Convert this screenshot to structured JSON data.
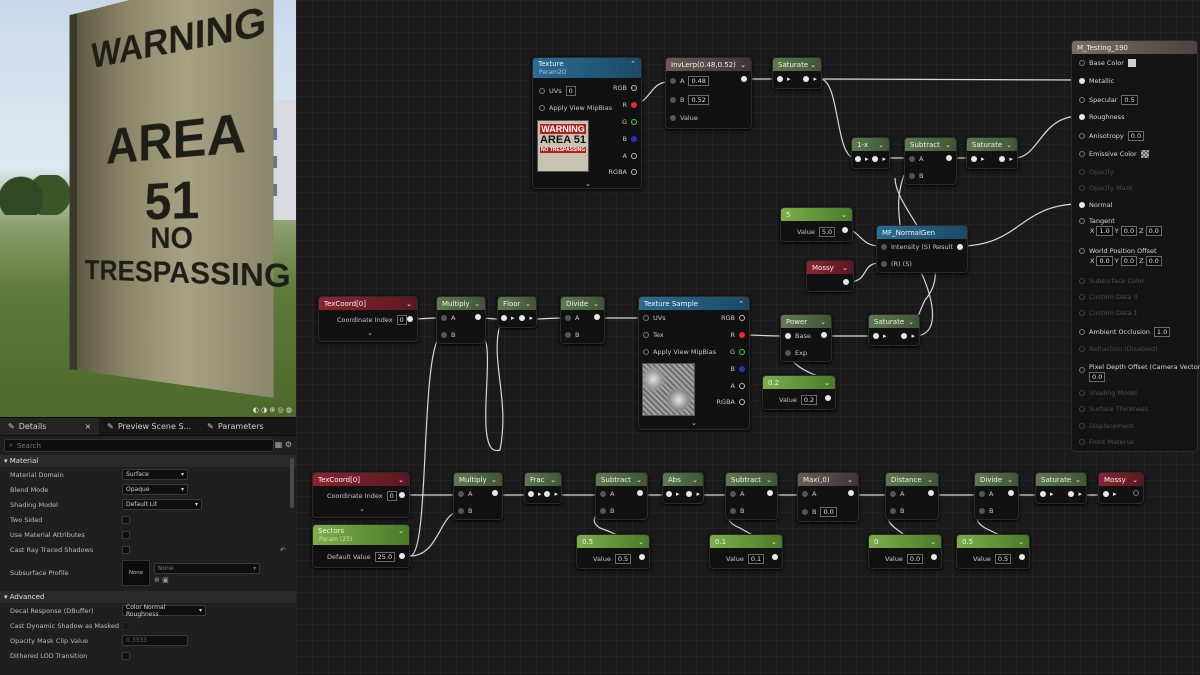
{
  "viewport": {
    "sign_lines": [
      "WARNING",
      "AREA 51",
      "NO TRESPASSING"
    ]
  },
  "details": {
    "tabs": [
      "Details",
      "Preview Scene S...",
      "Parameters"
    ],
    "search_placeholder": "Search",
    "sections": {
      "material": "Material",
      "advanced": "Advanced"
    },
    "rows": {
      "material_domain": {
        "label": "Material Domain",
        "value": "Surface"
      },
      "blend_mode": {
        "label": "Blend Mode",
        "value": "Opaque"
      },
      "shading_model": {
        "label": "Shading Model",
        "value": "Default Lit"
      },
      "two_sided": "Two Sided",
      "use_material_attributes": "Use Material Attributes",
      "cast_ray_traced_shadows": "Cast Ray Traced Shadows",
      "subsurface_profile": {
        "label": "Subsurface Profile",
        "thumb": "None",
        "value": "None"
      },
      "decal_response": {
        "label": "Decal Response (DBuffer)",
        "value": "Color Normal Roughness"
      },
      "cast_dynamic_shadow": "Cast Dynamic Shadow as Masked",
      "opacity_mask_clip": {
        "label": "Opacity Mask Clip Value",
        "value": "0.3333"
      },
      "dithered_lod": "Dithered LOD Transition"
    }
  },
  "nodes": {
    "texture": {
      "title": "Texture",
      "sub": "Param2D",
      "uvs": "UVs",
      "uvs_val": "0",
      "mip": "Apply View MipBias",
      "rgb": "RGB",
      "r": "R",
      "g": "G",
      "b": "B",
      "a": "A",
      "rgba": "RGBA",
      "thumb": [
        "WARNING",
        "AREA 51",
        "NO TRESPASSING"
      ]
    },
    "invlerp": {
      "title": "InvLerp(0.48,0.52)",
      "a": "A",
      "a_val": "0.48",
      "b": "B",
      "b_val": "0.52",
      "value": "Value"
    },
    "saturate1": {
      "title": "Saturate"
    },
    "oneminus": {
      "title": "1-x"
    },
    "subtract1": {
      "title": "Subtract",
      "a": "A",
      "b": "B"
    },
    "saturate2": {
      "title": "Saturate"
    },
    "five": {
      "title": "5",
      "value_label": "Value",
      "value": "5.0"
    },
    "normalgen": {
      "title": "MF_NormalGen",
      "intensity": "Intensity (S)",
      "result": "Result",
      "r": "(R) (S)"
    },
    "mossy1": {
      "title": "Mossy"
    },
    "texcoord1": {
      "title": "TexCoord[0]",
      "label": "Coordinate Index",
      "value": "0"
    },
    "multiply1": {
      "title": "Multiply",
      "a": "A",
      "b": "B"
    },
    "floor": {
      "title": "Floor"
    },
    "divide1": {
      "title": "Divide",
      "a": "A",
      "b": "B"
    },
    "texsample": {
      "title": "Texture Sample",
      "uvs": "UVs",
      "tex": "Tex",
      "mip": "Apply View MipBias",
      "rgb": "RGB",
      "r": "R",
      "g": "G",
      "b": "B",
      "a": "A",
      "rgba": "RGBA"
    },
    "power": {
      "title": "Power",
      "base": "Base",
      "exp": "Exp"
    },
    "saturate3": {
      "title": "Saturate"
    },
    "p02": {
      "title": "0.2",
      "value_label": "Value",
      "value": "0.2"
    },
    "texcoord2": {
      "title": "TexCoord[0]",
      "label": "Coordinate Index",
      "value": "0"
    },
    "sectors": {
      "title": "Sectors",
      "sub": "Param (25)",
      "label": "Default Value",
      "value": "25.0"
    },
    "multiply2": {
      "title": "Multiply",
      "a": "A",
      "b": "B"
    },
    "frac": {
      "title": "Frac"
    },
    "subtract2": {
      "title": "Subtract",
      "a": "A",
      "b": "B"
    },
    "abs": {
      "title": "Abs"
    },
    "subtract3": {
      "title": "Subtract",
      "a": "A",
      "b": "B"
    },
    "max": {
      "title": "Max(,0)",
      "a": "A",
      "b": "B",
      "b_val": "0.0"
    },
    "distance": {
      "title": "Distance",
      "a": "A",
      "b": "B"
    },
    "divide2": {
      "title": "Divide",
      "a": "A",
      "b": "B"
    },
    "saturate4": {
      "title": "Saturate"
    },
    "mossy2": {
      "title": "Mossy"
    },
    "c05a": {
      "title": "0.5",
      "value_label": "Value",
      "value": "0.5"
    },
    "c01": {
      "title": "0.1",
      "value_label": "Value",
      "value": "0.1"
    },
    "c0": {
      "title": "0",
      "value_label": "Value",
      "value": "0.0"
    },
    "c05b": {
      "title": "0.5",
      "value_label": "Value",
      "value": "0.5"
    }
  },
  "result": {
    "title": "M_Testing_190",
    "pins": {
      "base_color": "Base Color",
      "metallic": "Metallic",
      "specular": "Specular",
      "specular_val": "0.5",
      "roughness": "Roughness",
      "anisotropy": "Anisotropy",
      "anisotropy_val": "0.0",
      "emissive": "Emissive Color",
      "opacity": "Opacity",
      "opacity_mask": "Opacity Mask",
      "normal": "Normal",
      "tangent": "Tangent",
      "tangent_x": "1.0",
      "tangent_y": "0.0",
      "tangent_z": "0.0",
      "wpo": "World Position Offset",
      "wpo_x": "0.0",
      "wpo_y": "0.0",
      "wpo_z": "0.0",
      "subsurface": "Subsurface Color",
      "custom0": "Custom Data 0",
      "custom1": "Custom Data 1",
      "ao": "Ambient Occlusion",
      "ao_val": "1.0",
      "refraction": "Refraction (Disabled)",
      "pdo": "Pixel Depth Offset (Camera Vector)",
      "pdo_val": "0.0",
      "shading_model": "Shading Model",
      "surface_thickness": "Surface Thickness",
      "displacement": "Displacement",
      "front_material": "Front Material",
      "axis_x": "X",
      "axis_y": "Y",
      "axis_z": "Z"
    }
  }
}
